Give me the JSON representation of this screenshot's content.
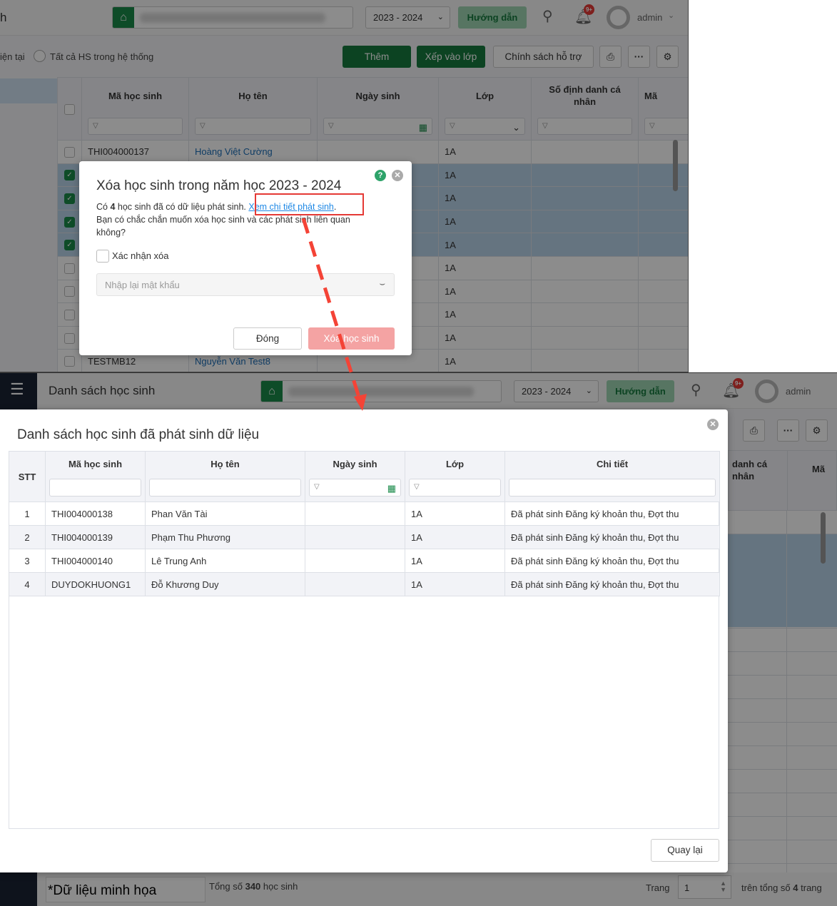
{
  "top_screen": {
    "title_fragment": "h",
    "year": "2023 - 2024",
    "guide_label": "Hướng dẫn",
    "notification_badge": "9+",
    "user": "admin",
    "radio_current_fragment": "iện tại",
    "radio_all_label": "Tất cả HS trong hệ thống",
    "buttons": {
      "add": "Thêm",
      "assign_class": "Xếp vào lớp",
      "support_policy": "Chính sách hỗ trợ"
    },
    "columns": [
      "Mã học sinh",
      "Họ tên",
      "Ngày sinh",
      "Lớp",
      "Số định danh cá nhân",
      "Mã"
    ],
    "filter_icon": "▽",
    "rows": [
      {
        "code": "THI004000137",
        "name": "Hoàng Việt Cường",
        "class": "1A",
        "checked": false
      },
      {
        "code": "",
        "name": "",
        "class": "1A",
        "checked": true
      },
      {
        "code": "",
        "name": "",
        "class": "1A",
        "checked": true
      },
      {
        "code": "",
        "name": "",
        "class": "1A",
        "checked": true
      },
      {
        "code": "",
        "name": "",
        "class": "1A",
        "checked": true
      },
      {
        "code": "",
        "name": "",
        "class": "1A",
        "checked": false
      },
      {
        "code": "",
        "name": "",
        "class": "1A",
        "checked": false
      },
      {
        "code": "",
        "name": "",
        "class": "1A",
        "checked": false
      },
      {
        "code": "",
        "name": "",
        "class": "1A",
        "checked": false
      },
      {
        "code": "TESTMB12",
        "name": "Nguyễn Văn Test8",
        "class": "1A",
        "checked": false
      }
    ]
  },
  "delete_dialog": {
    "title": "Xóa học sinh trong năm học 2023 - 2024",
    "msg_prefix": "Có ",
    "count": "4",
    "msg_mid": " học sinh đã có dữ liệu phát sinh. ",
    "detail_link": "Xem chi tiết phát sinh",
    "msg_end": ".",
    "msg_line2": "Bạn có chắc chắn muốn xóa học sinh và các phát sinh liên quan không?",
    "confirm_label": "Xác nhận xóa",
    "password_placeholder": "Nhập lại mật khẩu",
    "close_label": "Đóng",
    "delete_label": "Xóa học sinh",
    "help": "?"
  },
  "bottom_screen": {
    "page_title": "Danh sách học sinh",
    "year": "2023 - 2024",
    "guide_label": "Hướng dẫn",
    "notification_badge": "9+",
    "user": "admin",
    "bg_col_fragment": "danh cá nhân",
    "bg_col_ma": "Mã",
    "footer": {
      "note": "*Dữ liệu minh họa",
      "total_prefix": "Tổng số ",
      "total": "340",
      "total_suffix": " học sinh",
      "page_label": "Trang",
      "page": "1",
      "pages_prefix": "trên tổng số ",
      "pages": "4",
      "pages_suffix": " trang"
    }
  },
  "detail_dialog": {
    "title": "Danh sách học sinh đã phát sinh dữ liệu",
    "columns": [
      "STT",
      "Mã học sinh",
      "Họ tên",
      "Ngày sinh",
      "Lớp",
      "Chi tiết"
    ],
    "rows": [
      {
        "stt": "1",
        "code": "THI004000138",
        "name": "Phan Văn Tài",
        "dob": "",
        "class": "1A",
        "detail": "Đã phát sinh Đăng ký khoản thu, Đợt thu"
      },
      {
        "stt": "2",
        "code": "THI004000139",
        "name": "Phạm Thu Phương",
        "dob": "",
        "class": "1A",
        "detail": "Đã phát sinh Đăng ký khoản thu, Đợt thu"
      },
      {
        "stt": "3",
        "code": "THI004000140",
        "name": "Lê Trung Anh",
        "dob": "",
        "class": "1A",
        "detail": "Đã phát sinh Đăng ký khoản thu, Đợt thu"
      },
      {
        "stt": "4",
        "code": "DUYDOKHUONG1",
        "name": "Đỗ Khương Duy",
        "dob": "",
        "class": "1A",
        "detail": "Đã phát sinh Đăng ký khoản thu, Đợt thu"
      }
    ],
    "back_label": "Quay lại"
  },
  "colors": {
    "brand_green": "#167a3e",
    "highlight_red": "#e53935",
    "link_blue": "#1e88e5"
  }
}
